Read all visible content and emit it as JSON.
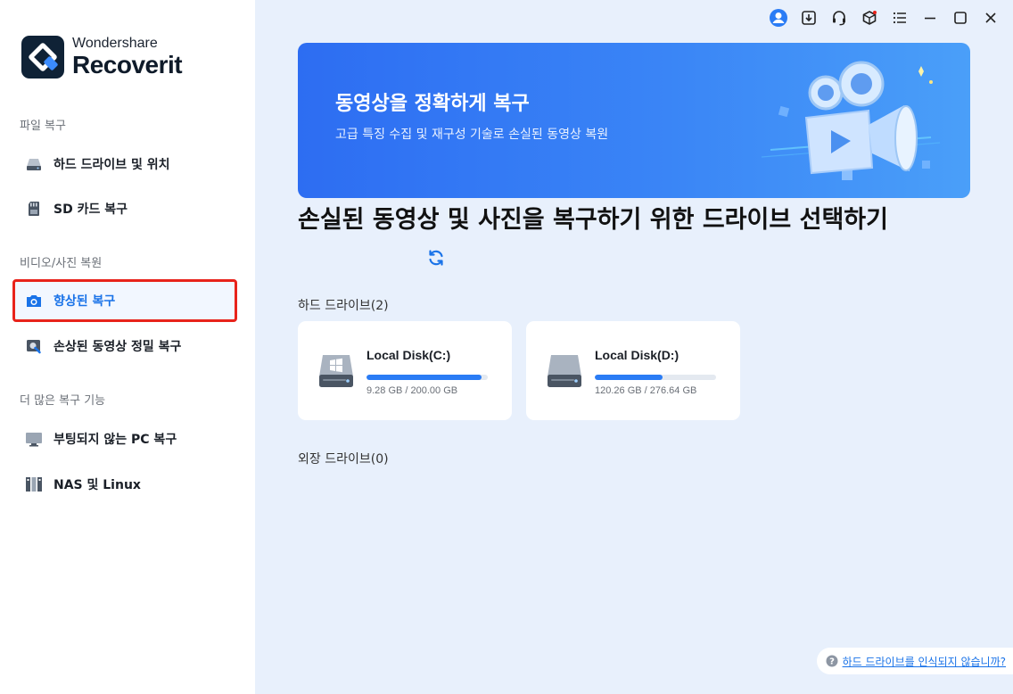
{
  "app": {
    "brand_top": "Wondershare",
    "brand_bottom": "Recoverit"
  },
  "sidebar": {
    "sections": [
      {
        "title": "파일 복구",
        "items": [
          {
            "label": "하드 드라이브 및 위치",
            "icon": "hard-drive-icon"
          },
          {
            "label": "SD 카드 복구",
            "icon": "sd-card-icon"
          }
        ]
      },
      {
        "title": "비디오/사진 복원",
        "items": [
          {
            "label": "향상된 복구",
            "icon": "camera-icon",
            "active": true
          },
          {
            "label": "손상된 동영상 정밀 복구",
            "icon": "video-repair-icon"
          }
        ]
      },
      {
        "title": "더 많은 복구 기능",
        "items": [
          {
            "label": "부팅되지 않는 PC 복구",
            "icon": "monitor-icon"
          },
          {
            "label": "NAS 및 Linux",
            "icon": "nas-icon"
          }
        ]
      }
    ]
  },
  "topbar": {
    "icons": [
      "user-avatar-icon",
      "update-icon",
      "headset-icon",
      "toolbox-icon",
      "menu-icon",
      "minimize-icon",
      "maximize-icon",
      "close-icon"
    ]
  },
  "banner": {
    "title": "동영상을 정확하게 복구",
    "subtitle": "고급 특징 수집 및 재구성 기술로 손실된 동영상 복원"
  },
  "main": {
    "heading": "손실된 동영상 및 사진을 복구하기 위한 드라이브 선택하기",
    "hard_drives_label": "하드 드라이브(2)",
    "external_drives_label": "외장 드라이브(0)",
    "drives": [
      {
        "name": "Local Disk(C:)",
        "size": "9.28 GB / 200.00 GB",
        "used_fraction": 0.95,
        "windows": true
      },
      {
        "name": "Local Disk(D:)",
        "size": "120.26 GB / 276.64 GB",
        "used_fraction": 0.56,
        "windows": false
      }
    ],
    "help_link": "하드 드라이브를 인식되지 않습니까?"
  },
  "colors": {
    "accent": "#1a73e8",
    "highlight_border": "#e8231b",
    "background": "#e8f0fc"
  }
}
